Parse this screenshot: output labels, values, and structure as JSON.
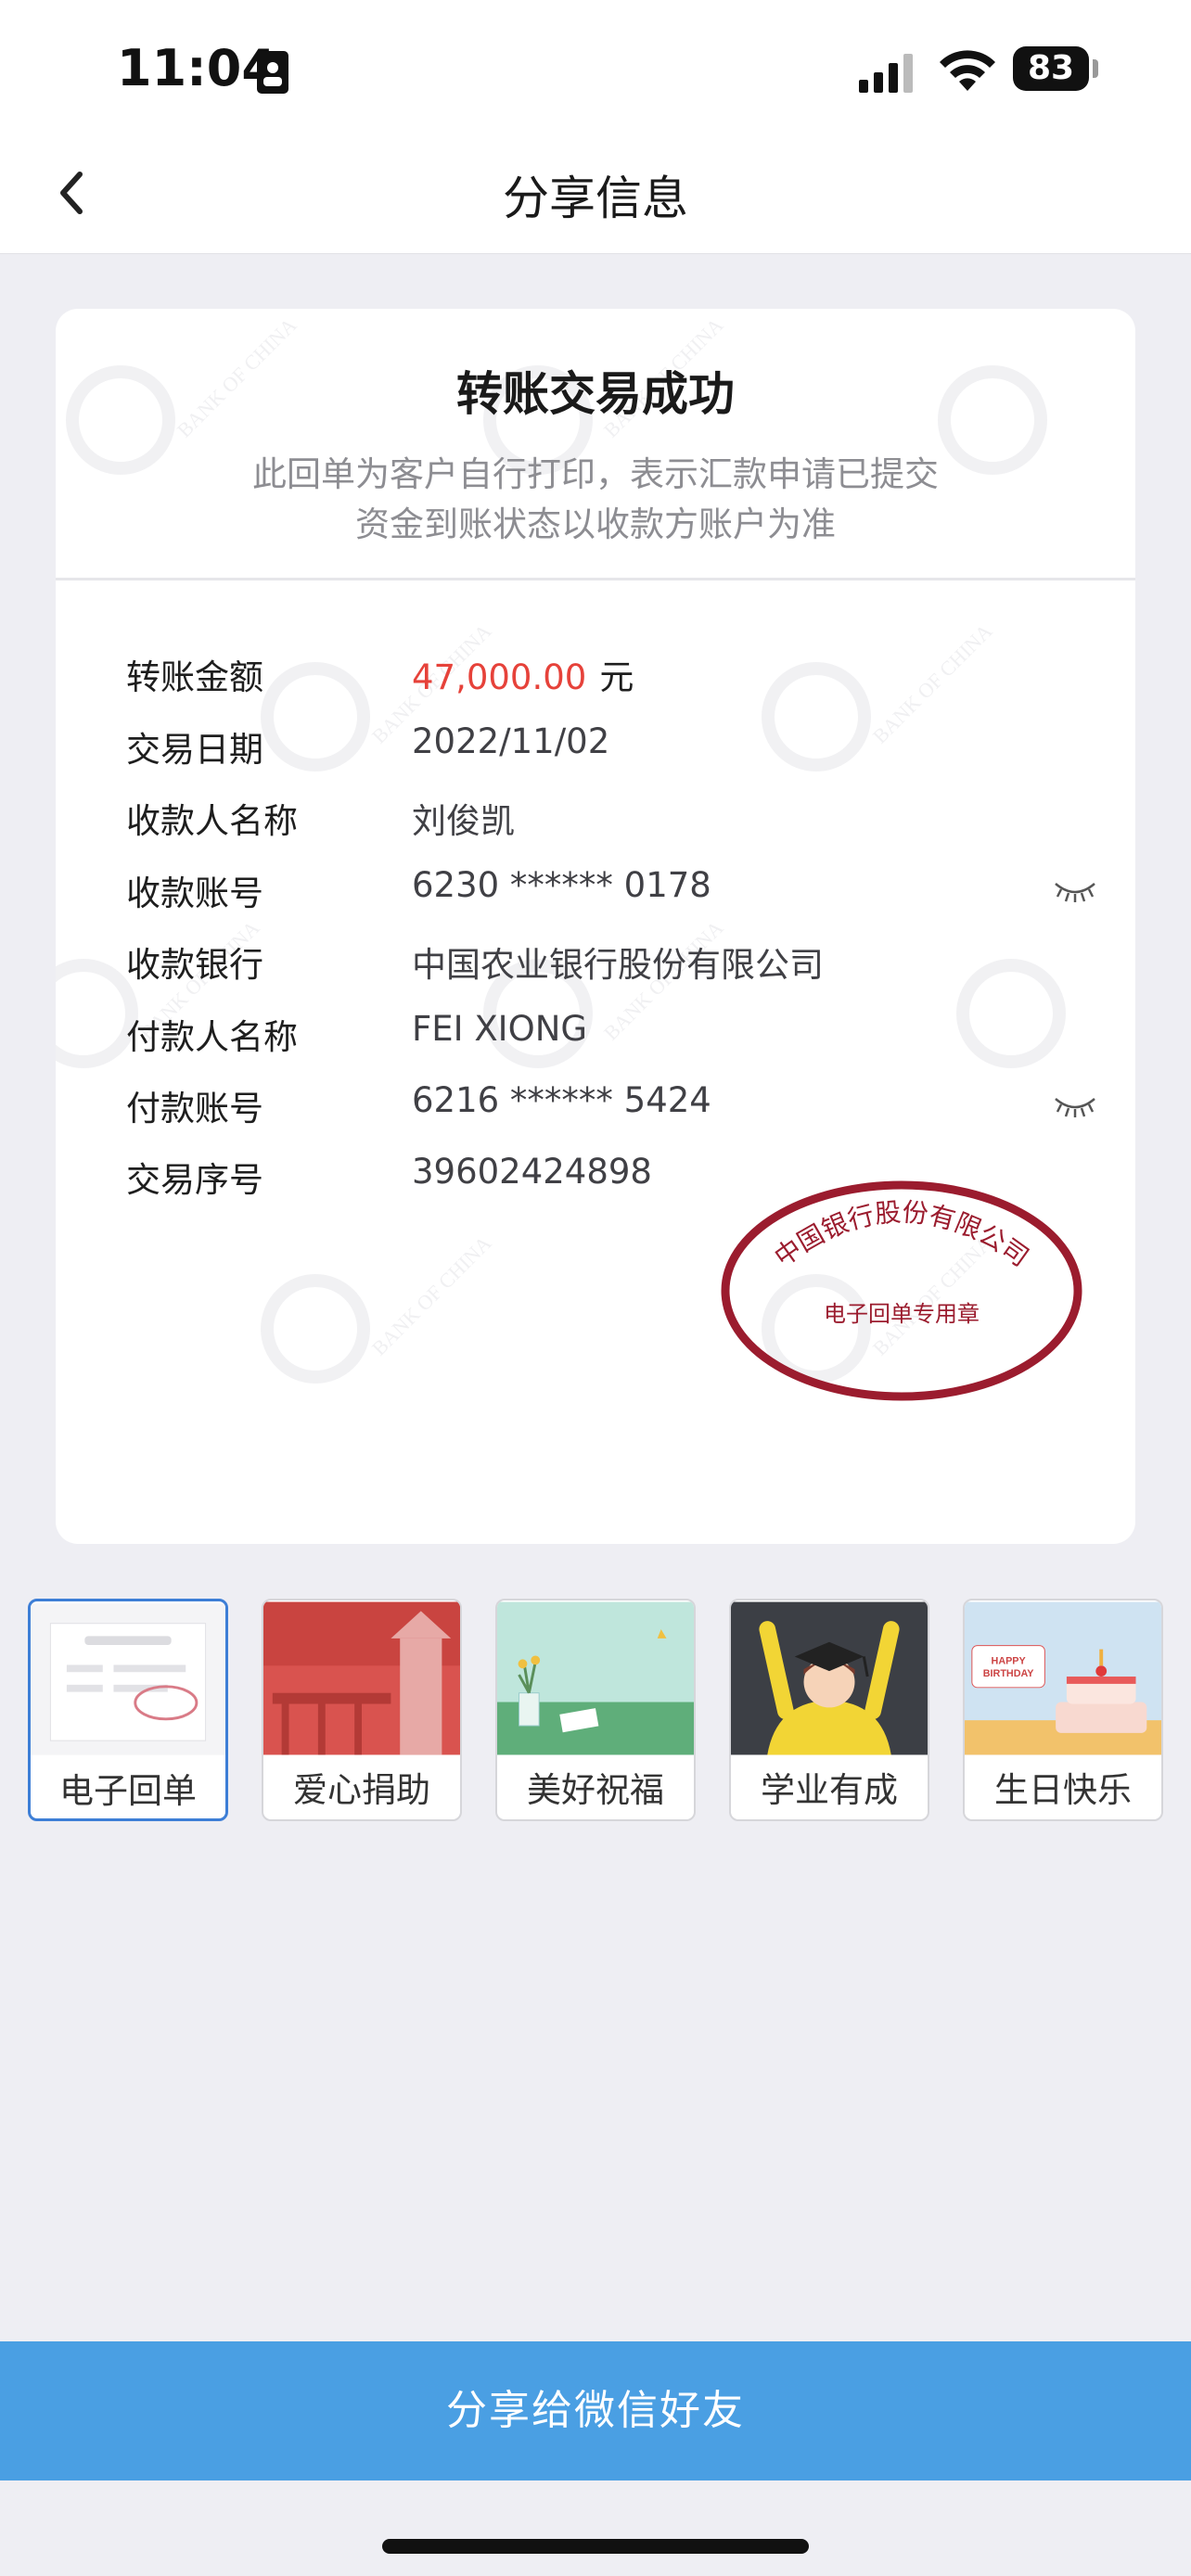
{
  "status_bar": {
    "time": "11:04",
    "battery": "83"
  },
  "nav": {
    "title": "分享信息"
  },
  "receipt": {
    "title": "转账交易成功",
    "note_line1": "此回单为客户自行打印，表示汇款申请已提交",
    "note_line2": "资金到账状态以收款方账户为准",
    "rows": [
      {
        "label": "转账金额",
        "value": "47,000.00",
        "unit": "元"
      },
      {
        "label": "交易日期",
        "value": "2022/11/02"
      },
      {
        "label": "收款人名称",
        "value": "刘俊凯"
      },
      {
        "label": "收款账号",
        "value": "6230 ****** 0178"
      },
      {
        "label": "收款银行",
        "value": "中国农业银行股份有限公司"
      },
      {
        "label": "付款人名称",
        "value": "FEI XIONG"
      },
      {
        "label": "付款账号",
        "value": "6216 ****** 5424"
      },
      {
        "label": "交易序号",
        "value": "39602424898"
      }
    ],
    "stamp_top": "中国银行股份有限公司",
    "stamp_bottom": "电子回单专用章",
    "watermark_text": "BANK OF CHINA"
  },
  "templates": [
    {
      "label": "电子回单",
      "selected": true
    },
    {
      "label": "爱心捐助"
    },
    {
      "label": "美好祝福"
    },
    {
      "label": "学业有成"
    },
    {
      "label": "生日快乐",
      "thumb_text": "HAPPY BIRTHDAY"
    }
  ],
  "share_button": "分享给微信好友",
  "colors": {
    "accent": "#4a9fe3",
    "amount": "#e6423a",
    "stamp": "#9b1c2e",
    "selected_border": "#3d7ed6"
  }
}
